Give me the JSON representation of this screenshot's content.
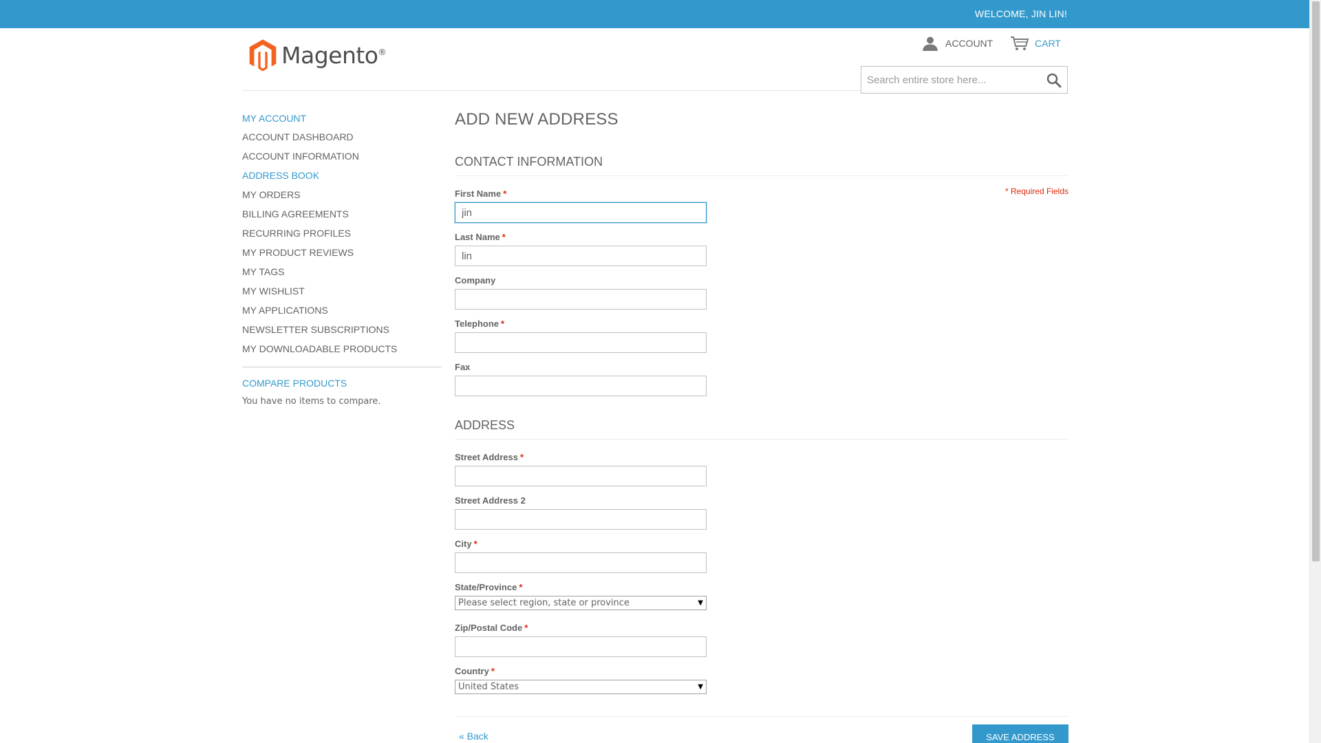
{
  "header": {
    "welcome": "WELCOME, JIN LIN!",
    "logo_text": "Magento",
    "logo_mark": "®",
    "account_label": "ACCOUNT",
    "cart_label": "CART",
    "search_placeholder": "Search entire store here..."
  },
  "sidebar": {
    "title": "MY ACCOUNT",
    "items": [
      {
        "label": "ACCOUNT DASHBOARD"
      },
      {
        "label": "ACCOUNT INFORMATION"
      },
      {
        "label": "ADDRESS BOOK"
      },
      {
        "label": "MY ORDERS"
      },
      {
        "label": "BILLING AGREEMENTS"
      },
      {
        "label": "RECURRING PROFILES"
      },
      {
        "label": "MY PRODUCT REVIEWS"
      },
      {
        "label": "MY TAGS"
      },
      {
        "label": "MY WISHLIST"
      },
      {
        "label": "MY APPLICATIONS"
      },
      {
        "label": "NEWSLETTER SUBSCRIPTIONS"
      },
      {
        "label": "MY DOWNLOADABLE PRODUCTS"
      }
    ],
    "compare_title": "COMPARE PRODUCTS",
    "compare_empty": "You have no items to compare."
  },
  "main": {
    "page_title": "ADD NEW ADDRESS",
    "contact_title": "CONTACT INFORMATION",
    "required_note": "* Required Fields",
    "address_title": "ADDRESS",
    "req_mark": "*",
    "fields": {
      "first_name": {
        "label": "First Name",
        "value": "jin"
      },
      "last_name": {
        "label": "Last Name",
        "value": "lin"
      },
      "company": {
        "label": "Company",
        "value": ""
      },
      "telephone": {
        "label": "Telephone",
        "value": ""
      },
      "fax": {
        "label": "Fax",
        "value": ""
      },
      "street1": {
        "label": "Street Address",
        "value": ""
      },
      "street2": {
        "label": "Street Address 2",
        "value": ""
      },
      "city": {
        "label": "City",
        "value": ""
      },
      "state": {
        "label": "State/Province",
        "value": "Please select region, state or province"
      },
      "zip": {
        "label": "Zip/Postal Code",
        "value": ""
      },
      "country": {
        "label": "Country",
        "value": "United States"
      }
    },
    "back_label": "« Back",
    "save_label": "SAVE ADDRESS"
  },
  "colors": {
    "accent": "#3399cc",
    "required": "#df280a",
    "logo_orange": "#f26322"
  }
}
